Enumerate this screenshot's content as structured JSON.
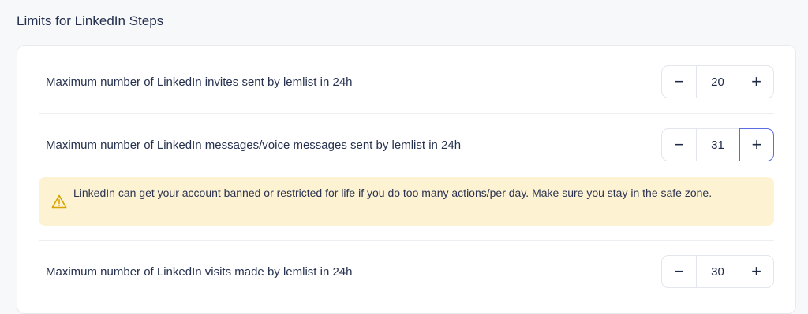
{
  "section": {
    "title": "Limits for LinkedIn Steps"
  },
  "limits": [
    {
      "label": "Maximum number of LinkedIn invites sent by lemlist in 24h",
      "value": "20"
    },
    {
      "label": "Maximum number of LinkedIn messages/voice messages sent by lemlist in 24h",
      "value": "31"
    },
    {
      "label": "Maximum number of LinkedIn visits made by lemlist in 24h",
      "value": "30"
    }
  ],
  "stepper": {
    "minus": "−",
    "plus": "+"
  },
  "warning": {
    "icon": "warning-triangle-icon",
    "text": "LinkedIn can get your account banned or restricted for life if you do too many actions/per day. Make sure you stay in the safe zone."
  },
  "colors": {
    "warning_bg": "#fdf3d3",
    "focus_border": "#5b6ee1",
    "warning_icon": "#d9a300"
  }
}
